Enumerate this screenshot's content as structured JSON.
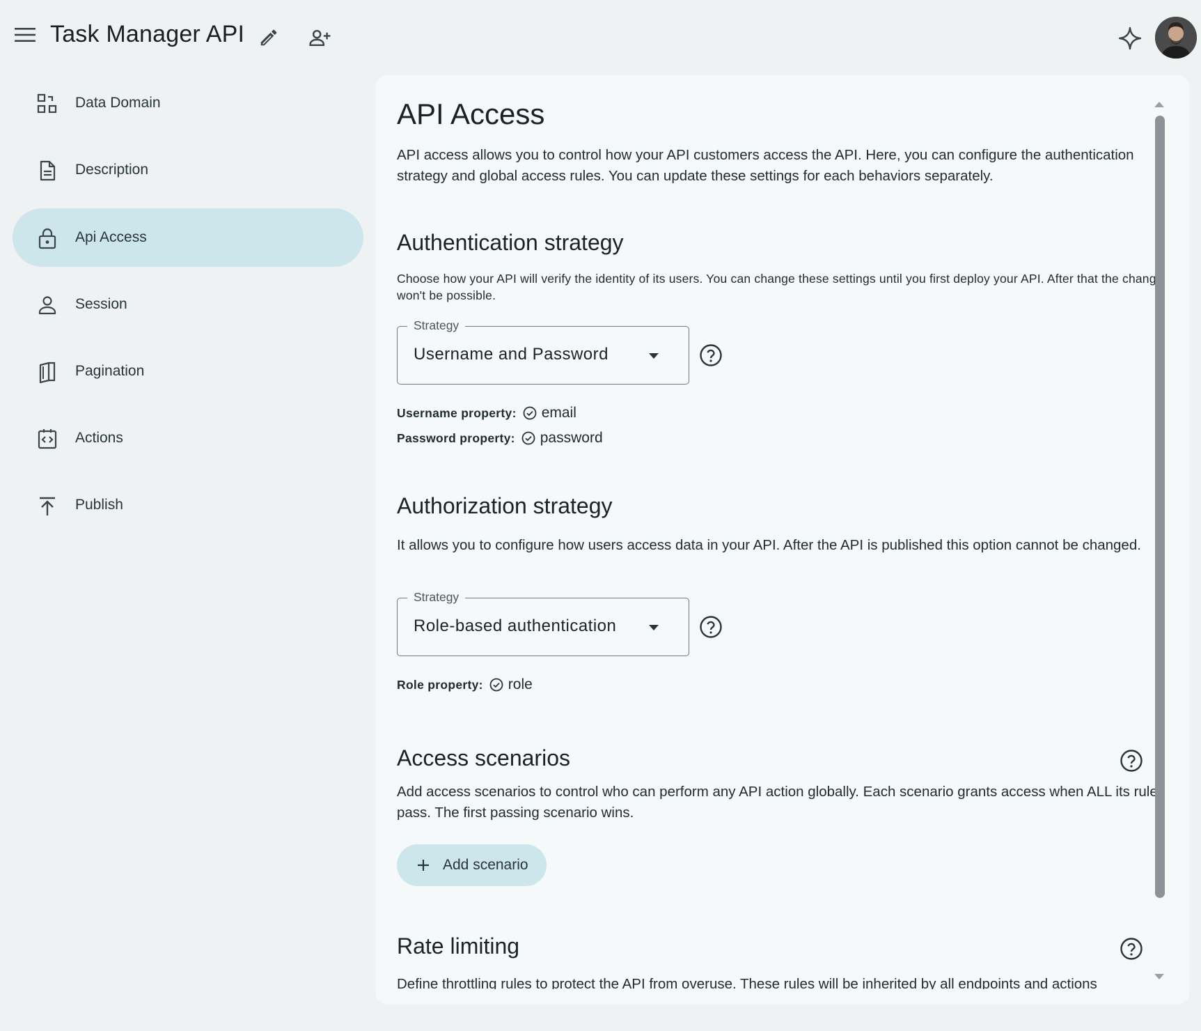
{
  "header": {
    "app_title": "Task Manager API",
    "menu_icon": "menu-icon",
    "edit_icon": "pencil-icon",
    "share_icon": "person-add-icon",
    "ai_icon": "sparkle-icon"
  },
  "sidebar": {
    "items": [
      {
        "label": "Data Domain",
        "icon": "data-domain-icon"
      },
      {
        "label": "Description",
        "icon": "document-icon"
      },
      {
        "label": "Api Access",
        "icon": "lock-icon",
        "active": true
      },
      {
        "label": "Session",
        "icon": "person-icon"
      },
      {
        "label": "Pagination",
        "icon": "book-icon"
      },
      {
        "label": "Actions",
        "icon": "code-icon"
      },
      {
        "label": "Publish",
        "icon": "upload-icon"
      }
    ]
  },
  "main": {
    "title": "API Access",
    "intro": "API access allows you to control how your API customers access the API. Here, you can configure the authentication strategy and global access rules. You can update these settings for each behaviors separately.",
    "authentication": {
      "heading": "Authentication strategy",
      "description": "Choose how your API will verify the identity of its users. You can change these settings until you first deploy your API. After that the change won't be possible.",
      "select_label": "Strategy",
      "select_value": "Username and Password",
      "username_label": "Username property:",
      "username_value": "email",
      "password_label": "Password property:",
      "password_value": "password"
    },
    "authorization": {
      "heading": "Authorization strategy",
      "description": "It allows you to configure how users access data in your API. After the API is published this option cannot be changed.",
      "select_label": "Strategy",
      "select_value": "Role-based authentication",
      "role_label": "Role property:",
      "role_value": "role"
    },
    "scenarios": {
      "heading": "Access scenarios",
      "description": "Add access scenarios to control who can perform any API action globally. Each scenario grants access when ALL its rules pass. The first passing scenario wins.",
      "add_label": "Add scenario"
    },
    "rate_limiting": {
      "heading": "Rate limiting",
      "description": "Define throttling rules to protect the API from overuse. These rules will be inherited by all endpoints and actions"
    }
  },
  "colors": {
    "accent": "#cde6ec",
    "background": "#eef2f3",
    "panel": "#f5f9fa",
    "text": "#1f2a2d"
  }
}
